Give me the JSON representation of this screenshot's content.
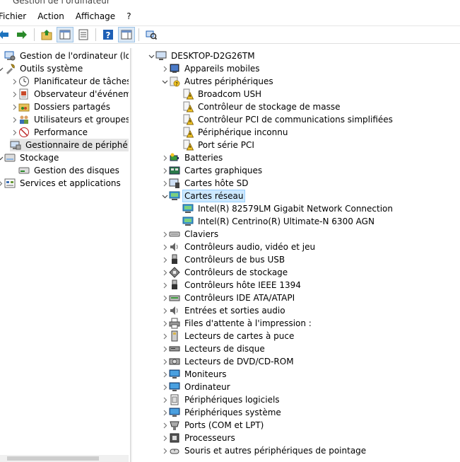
{
  "window": {
    "title": "Gestion de l'ordinateur"
  },
  "menu": [
    "Fichier",
    "Action",
    "Affichage",
    "?"
  ],
  "toolbar": {
    "buttons": [
      "back-arrow-icon",
      "forward-arrow-icon",
      "up-folder-icon",
      "console-tree-icon",
      "properties-icon",
      "help-icon",
      "show-hide-icon",
      "scan-hardware-icon"
    ]
  },
  "left_tree": [
    {
      "label": "Gestion de l'ordinateur (local)",
      "level": 0,
      "chev": "",
      "icon": "computer-management-icon"
    },
    {
      "label": "Outils système",
      "level": 0,
      "chev": "open",
      "icon": "system-tools-icon"
    },
    {
      "label": "Planificateur de tâches",
      "level": 1,
      "chev": "closed",
      "icon": "clock-icon"
    },
    {
      "label": "Observateur d'événeme",
      "level": 1,
      "chev": "closed",
      "icon": "event-viewer-icon"
    },
    {
      "label": "Dossiers partagés",
      "level": 1,
      "chev": "closed",
      "icon": "shared-folder-icon"
    },
    {
      "label": "Utilisateurs et groupes l",
      "level": 1,
      "chev": "closed",
      "icon": "users-icon"
    },
    {
      "label": "Performance",
      "level": 1,
      "chev": "closed",
      "icon": "performance-icon"
    },
    {
      "label": "Gestionnaire de périphé",
      "level": 1,
      "chev": "",
      "icon": "device-manager-icon",
      "selected": true
    },
    {
      "label": "Stockage",
      "level": 0,
      "chev": "open",
      "icon": "storage-icon"
    },
    {
      "label": "Gestion des disques",
      "level": 1,
      "chev": "",
      "icon": "disk-management-icon"
    },
    {
      "label": "Services et applications",
      "level": 0,
      "chev": "closed",
      "icon": "services-icon"
    }
  ],
  "right_tree": [
    {
      "label": "DESKTOP-D2G26TM",
      "level": 0,
      "chev": "open",
      "icon": "desktop-computer-icon"
    },
    {
      "label": "Appareils mobiles",
      "level": 1,
      "chev": "closed",
      "icon": "mobile-device-icon"
    },
    {
      "label": "Autres périphériques",
      "level": 1,
      "chev": "open",
      "icon": "unknown-device-icon"
    },
    {
      "label": "Broadcom USH",
      "level": 2,
      "chev": "",
      "icon": "warning-device-icon"
    },
    {
      "label": "Contrôleur de stockage de masse",
      "level": 2,
      "chev": "",
      "icon": "warning-device-icon"
    },
    {
      "label": "Contrôleur PCI de communications simplifiées",
      "level": 2,
      "chev": "",
      "icon": "warning-device-icon"
    },
    {
      "label": "Périphérique inconnu",
      "level": 2,
      "chev": "",
      "icon": "warning-device-icon"
    },
    {
      "label": "Port série PCI",
      "level": 2,
      "chev": "",
      "icon": "warning-device-icon"
    },
    {
      "label": "Batteries",
      "level": 1,
      "chev": "closed",
      "icon": "battery-icon"
    },
    {
      "label": "Cartes graphiques",
      "level": 1,
      "chev": "closed",
      "icon": "display-adapter-icon"
    },
    {
      "label": "Cartes hôte SD",
      "level": 1,
      "chev": "closed",
      "icon": "sd-host-icon"
    },
    {
      "label": "Cartes réseau",
      "level": 1,
      "chev": "open",
      "icon": "network-adapter-icon",
      "selected": true
    },
    {
      "label": "Intel(R) 82579LM Gigabit Network Connection",
      "level": 2,
      "chev": "",
      "icon": "network-adapter-icon"
    },
    {
      "label": "Intel(R) Centrino(R) Ultimate-N 6300 AGN",
      "level": 2,
      "chev": "",
      "icon": "network-adapter-icon"
    },
    {
      "label": "Claviers",
      "level": 1,
      "chev": "closed",
      "icon": "keyboard-icon"
    },
    {
      "label": "Contrôleurs audio, vidéo et jeu",
      "level": 1,
      "chev": "closed",
      "icon": "speaker-icon"
    },
    {
      "label": "Contrôleurs de bus USB",
      "level": 1,
      "chev": "closed",
      "icon": "usb-icon"
    },
    {
      "label": "Contrôleurs de stockage",
      "level": 1,
      "chev": "closed",
      "icon": "storage-controller-icon"
    },
    {
      "label": "Contrôleurs hôte IEEE 1394",
      "level": 1,
      "chev": "closed",
      "icon": "usb-icon"
    },
    {
      "label": "Contrôleurs IDE ATA/ATAPI",
      "level": 1,
      "chev": "closed",
      "icon": "ide-icon"
    },
    {
      "label": "Entrées et sorties audio",
      "level": 1,
      "chev": "closed",
      "icon": "speaker-icon"
    },
    {
      "label": "Files d'attente à l'impression :",
      "level": 1,
      "chev": "closed",
      "icon": "printer-icon"
    },
    {
      "label": "Lecteurs de cartes à puce",
      "level": 1,
      "chev": "closed",
      "icon": "smartcard-icon"
    },
    {
      "label": "Lecteurs de disque",
      "level": 1,
      "chev": "closed",
      "icon": "disk-drive-icon"
    },
    {
      "label": "Lecteurs de DVD/CD-ROM",
      "level": 1,
      "chev": "closed",
      "icon": "dvd-icon"
    },
    {
      "label": "Moniteurs",
      "level": 1,
      "chev": "closed",
      "icon": "monitor-icon"
    },
    {
      "label": "Ordinateur",
      "level": 1,
      "chev": "closed",
      "icon": "monitor-icon"
    },
    {
      "label": "Périphériques logiciels",
      "level": 1,
      "chev": "closed",
      "icon": "software-device-icon"
    },
    {
      "label": "Périphériques système",
      "level": 1,
      "chev": "closed",
      "icon": "monitor-icon"
    },
    {
      "label": "Ports (COM et LPT)",
      "level": 1,
      "chev": "closed",
      "icon": "port-icon"
    },
    {
      "label": "Processeurs",
      "level": 1,
      "chev": "closed",
      "icon": "processor-icon"
    },
    {
      "label": "Souris et autres périphériques de pointage",
      "level": 1,
      "chev": "closed",
      "icon": "mouse-icon"
    }
  ],
  "colors": {
    "selection": "#cce8ff",
    "selection_border": "#99d1ff",
    "inactive_selection": "#e5e5e5",
    "accent_blue": "#1e73be",
    "warning_yellow": "#f3c623"
  }
}
